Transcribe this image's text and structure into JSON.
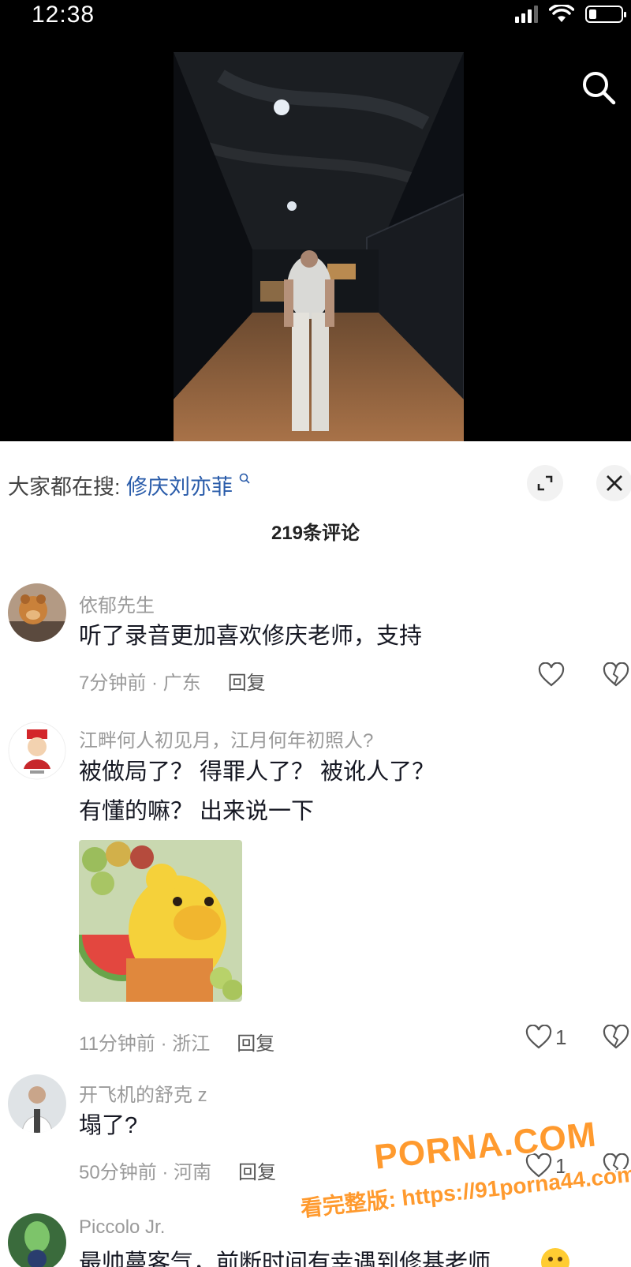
{
  "status_bar": {
    "time": "12:38"
  },
  "hot_search": {
    "prefix": "大家都在搜:",
    "keyword": "修庆刘亦菲"
  },
  "comments_header": {
    "count_label": "219条评论"
  },
  "comments": [
    {
      "name": "依郁先生",
      "text_lines": [
        "听了录音更加喜欢修庆老师，支持"
      ],
      "time_location": "7分钟前 · 广东",
      "reply": "回复",
      "likes": ""
    },
    {
      "name": "江畔何人初见月，江月何年初照人?",
      "text_lines": [
        "被做局了？ 得罪人了？ 被讹人了？",
        " 有懂的嘛？ 出来说一下"
      ],
      "time_location": "11分钟前 · 浙江",
      "reply": "回复",
      "likes": "1"
    },
    {
      "name": "开飞机的舒克 z",
      "text_lines": [
        "塌了?"
      ],
      "time_location": "50分钟前 · 河南",
      "reply": "回复",
      "likes": "1"
    },
    {
      "name": "Piccolo Jr.",
      "text_lines": [
        "最帅蔓客气，前断时间有幸遇到修基老师"
      ],
      "time_location": "",
      "reply": "",
      "likes": ""
    }
  ],
  "watermark": {
    "main": "PORNA.COM",
    "sub": "看完整版: https://91porna44.com"
  },
  "colors": {
    "keyword": "#2a5caa",
    "watermark": "#ff9a2e"
  }
}
